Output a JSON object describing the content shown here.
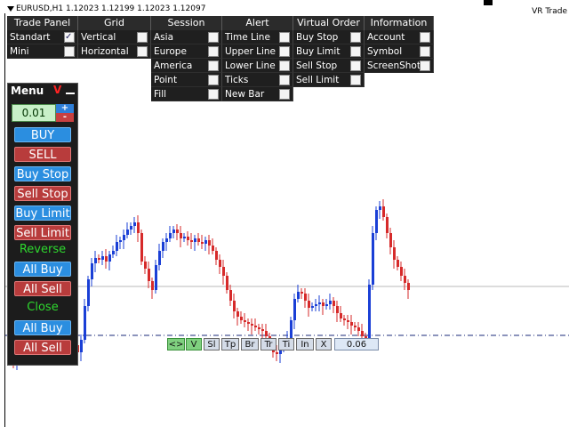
{
  "header": {
    "symbol_title": "EURUSD,H1  1.12023 1.12199 1.12023 1.12097",
    "indicator_name": "VR Trade"
  },
  "menu": {
    "columns": [
      {
        "title": "Trade Panel",
        "items": [
          {
            "label": "Standart",
            "checked": true
          },
          {
            "label": "Mini",
            "checked": false
          }
        ]
      },
      {
        "title": "Grid",
        "items": [
          {
            "label": "Vertical",
            "checked": false
          },
          {
            "label": "Horizontal",
            "checked": false
          }
        ]
      },
      {
        "title": "Session",
        "items": [
          {
            "label": "Asia",
            "checked": false
          },
          {
            "label": "Europe",
            "checked": false
          },
          {
            "label": "America",
            "checked": false
          },
          {
            "label": "Point",
            "checked": false
          },
          {
            "label": "Fill",
            "checked": false
          }
        ]
      },
      {
        "title": "Alert",
        "items": [
          {
            "label": "Time Line",
            "checked": false
          },
          {
            "label": "Upper Line",
            "checked": false
          },
          {
            "label": "Lower Line",
            "checked": false
          },
          {
            "label": "Ticks",
            "checked": false
          },
          {
            "label": "New Bar",
            "checked": false
          }
        ]
      },
      {
        "title": "Virtual Order",
        "items": [
          {
            "label": "Buy Stop",
            "checked": false
          },
          {
            "label": "Buy Limit",
            "checked": false
          },
          {
            "label": "Sell Stop",
            "checked": false
          },
          {
            "label": "Sell Limit",
            "checked": false
          }
        ]
      },
      {
        "title": "Information",
        "items": [
          {
            "label": "Account",
            "checked": false
          },
          {
            "label": "Symbol",
            "checked": false
          },
          {
            "label": "ScreenShot",
            "checked": false
          }
        ]
      }
    ]
  },
  "trade_panel": {
    "title": "Menu",
    "close_label": "V",
    "lot_value": "0.01",
    "plus": "+",
    "minus": "-",
    "buy": "BUY",
    "sell": "SELL",
    "buy_stop": "Buy Stop",
    "sell_stop": "Sell Stop",
    "buy_limit": "Buy Limit",
    "sell_limit": "Sell Limit",
    "reverse": "Reverse",
    "reverse_all_buy": "All Buy",
    "reverse_all_sell": "All Sell",
    "close": "Close",
    "close_all_buy": "All Buy",
    "close_all_sell": "All Sell"
  },
  "toolbar": {
    "buttons": [
      "<>",
      "V",
      "Sl",
      "Tp",
      "Br",
      "Tr",
      "Ti",
      "In",
      "X"
    ],
    "value": "0.06"
  },
  "colors": {
    "bull": "#1a3fd6",
    "bear": "#d62a2a",
    "hline": "#b8b8b8",
    "dashline": "#1a2a7a"
  }
}
